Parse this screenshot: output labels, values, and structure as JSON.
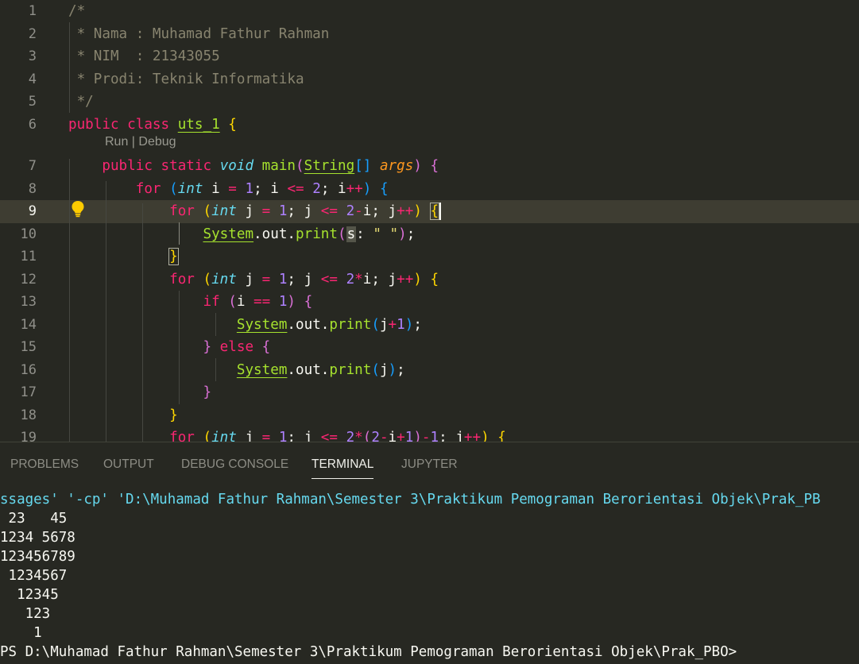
{
  "editor": {
    "codelens": "Run | Debug",
    "lines": [
      {
        "n": "1",
        "text": "/*"
      },
      {
        "n": "2",
        "text": " * Nama : Muhamad Fathur Rahman"
      },
      {
        "n": "3",
        "text": " * NIM  : 21343055"
      },
      {
        "n": "4",
        "text": " * Prodi: Teknik Informatika"
      },
      {
        "n": "5",
        "text": " */"
      },
      {
        "n": "6",
        "text": "public class uts_1 {"
      },
      {
        "n": "7",
        "text": "    public static void main(String[] args) {"
      },
      {
        "n": "8",
        "text": "        for (int i = 1; i <= 2; i++) {"
      },
      {
        "n": "9",
        "text": "            for (int j = 1; j <= 2-i; j++) {"
      },
      {
        "n": "10",
        "text": "                System.out.print(s: \" \");"
      },
      {
        "n": "11",
        "text": "            }"
      },
      {
        "n": "12",
        "text": "            for (int j = 1; j <= 2*i; j++) {"
      },
      {
        "n": "13",
        "text": "                if (i == 1) {"
      },
      {
        "n": "14",
        "text": "                    System.out.print(j+1);"
      },
      {
        "n": "15",
        "text": "                } else {"
      },
      {
        "n": "16",
        "text": "                    System.out.print(j);"
      },
      {
        "n": "17",
        "text": "                }"
      },
      {
        "n": "18",
        "text": "            }"
      },
      {
        "n": "19",
        "text": "            for (int j = 1; j <= 2*(2-i+1)-1; j++) {"
      }
    ]
  },
  "panel": {
    "tabs": [
      {
        "id": "problems",
        "label": "PROBLEMS"
      },
      {
        "id": "output",
        "label": "OUTPUT"
      },
      {
        "id": "debug-console",
        "label": "DEBUG CONSOLE"
      },
      {
        "id": "terminal",
        "label": "TERMINAL",
        "active": true
      },
      {
        "id": "jupyter",
        "label": "JUPYTER"
      }
    ],
    "terminal_lines": [
      "ssages' '-cp' 'D:\\Muhamad Fathur Rahman\\Semester 3\\Praktikum Pemograman Berorientasi Objek\\Prak_PB",
      " 23   45",
      "1234 5678",
      "123456789",
      " 1234567",
      "  12345",
      "   123",
      "    1",
      "PS D:\\Muhamad Fathur Rahman\\Semester 3\\Praktikum Pemograman Berorientasi Objek\\Prak_PBO>"
    ]
  },
  "theme": {
    "editor_bg": "#272822",
    "active_line_bg": "#3e3d32",
    "keyword": "#f92672",
    "function": "#a6e22e",
    "number": "#ae81ff",
    "string": "#e6db74",
    "comment": "#88846f",
    "type": "#66d9ef"
  },
  "icons": {
    "gutter_hint": "lightbulb-icon"
  }
}
